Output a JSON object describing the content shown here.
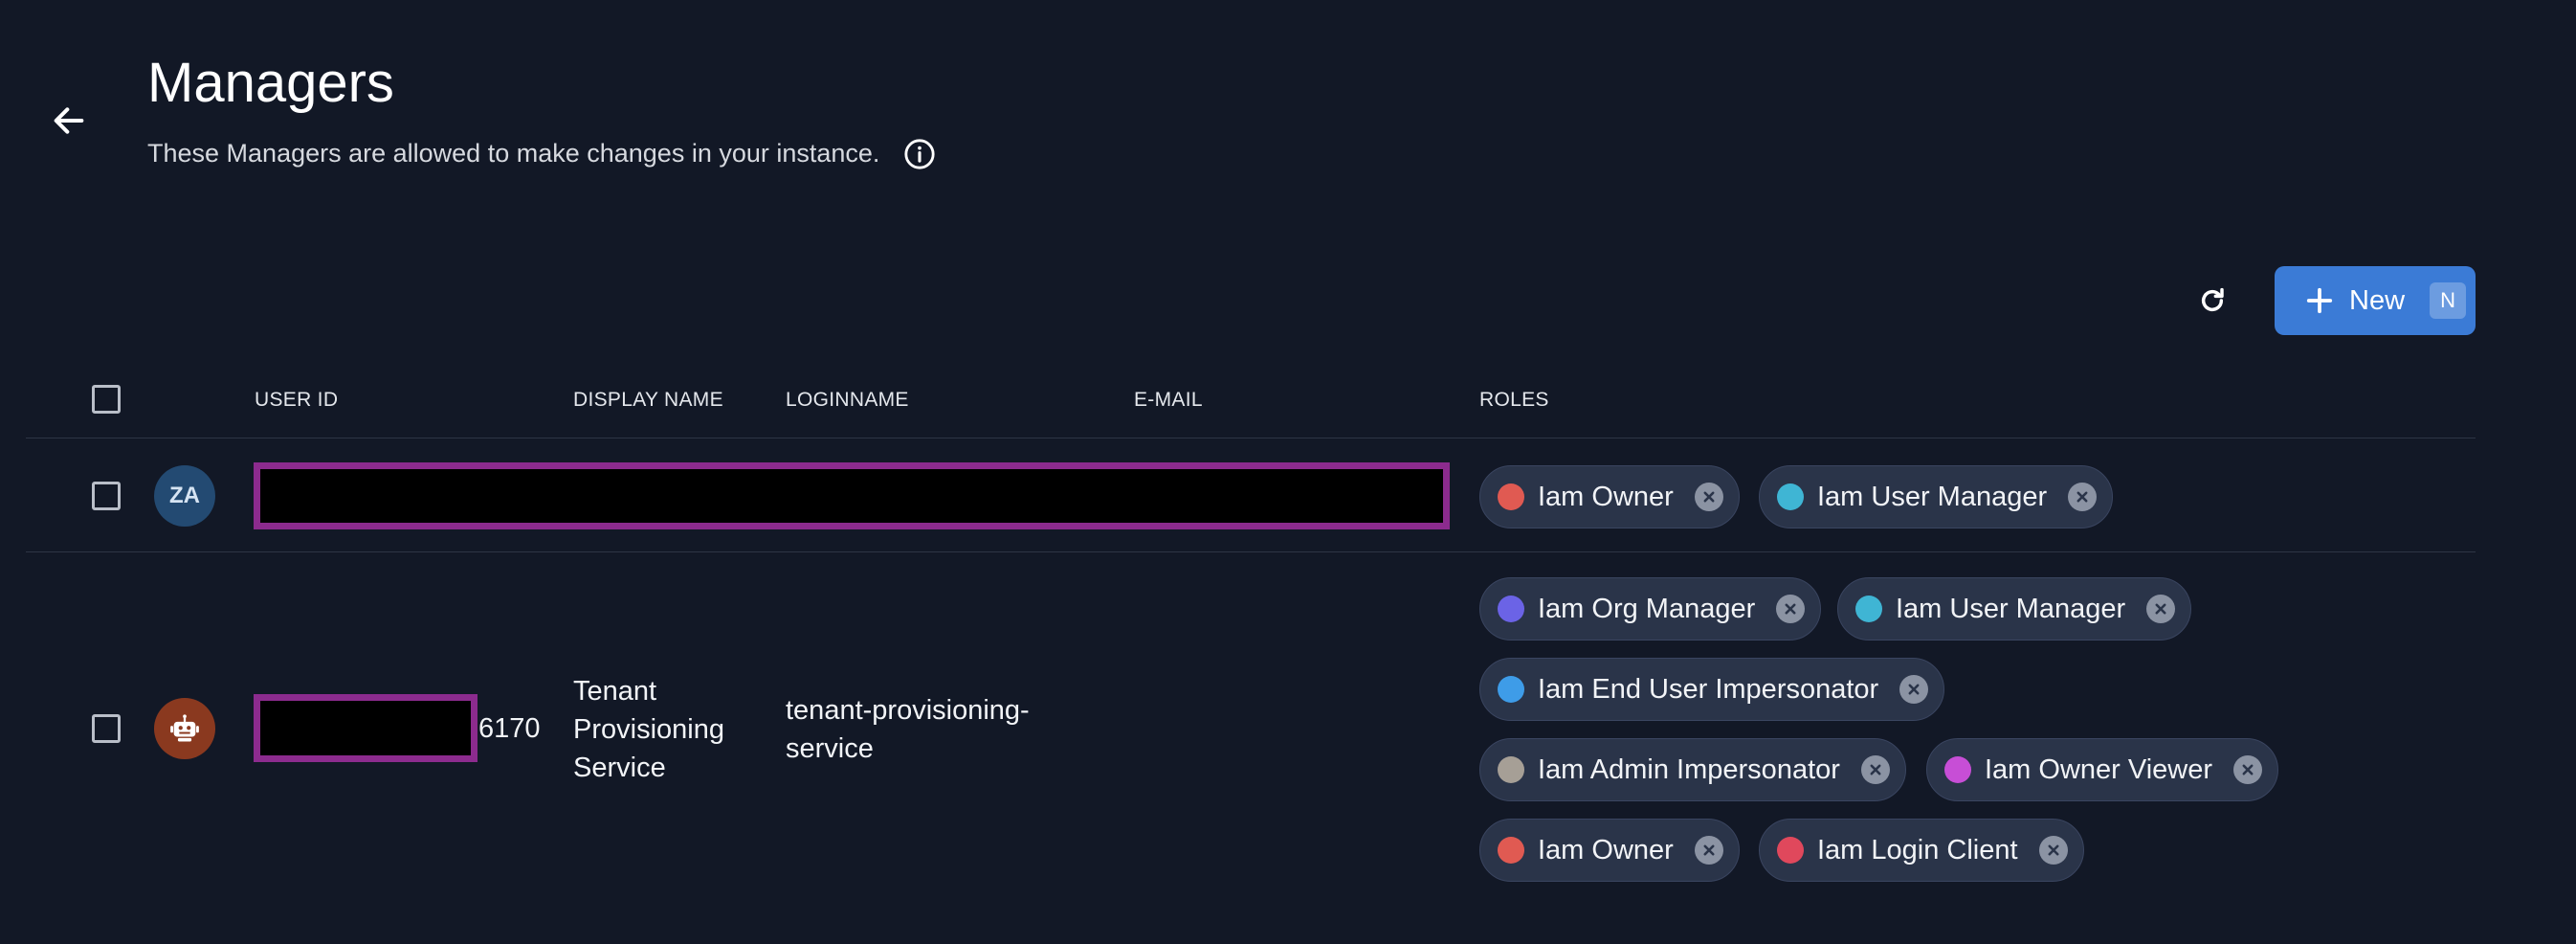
{
  "header": {
    "title": "Managers",
    "subtitle": "These Managers are allowed to make changes in your instance."
  },
  "toolbar": {
    "new_label": "New",
    "new_shortcut": "N"
  },
  "table": {
    "columns": [
      "USER ID",
      "DISPLAY NAME",
      "LOGINNAME",
      "E-MAIL",
      "ROLES"
    ],
    "rows": [
      {
        "avatar_initials": "ZA",
        "roles": [
          {
            "label": "Iam Owner",
            "color": "#e05a52"
          },
          {
            "label": "Iam User Manager",
            "color": "#3fb5d4"
          }
        ]
      },
      {
        "avatar_icon": "robot-icon",
        "user_id_suffix": "6170",
        "display_name": "Tenant Provisioning Service",
        "loginname": "tenant-provisioning-service",
        "roles": [
          {
            "label": "Iam Org Manager",
            "color": "#6b63e6"
          },
          {
            "label": "Iam User Manager",
            "color": "#3fb5d4"
          },
          {
            "label": "Iam End User Impersonator",
            "color": "#3e9ce8"
          },
          {
            "label": "Iam Admin Impersonator",
            "color": "#a69f96"
          },
          {
            "label": "Iam Owner Viewer",
            "color": "#c74ed6"
          },
          {
            "label": "Iam Owner",
            "color": "#e05a52"
          },
          {
            "label": "Iam Login Client",
            "color": "#e0485c"
          }
        ]
      }
    ]
  }
}
